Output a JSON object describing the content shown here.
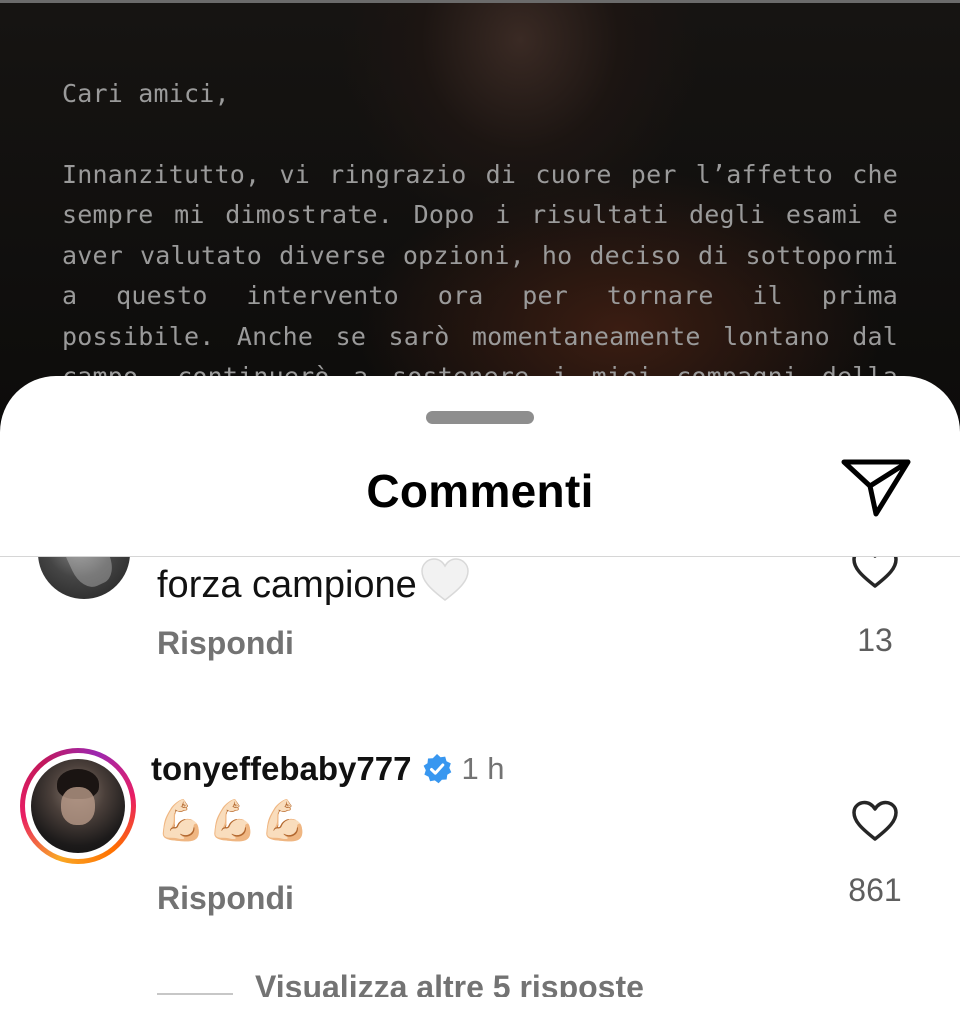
{
  "post": {
    "greeting": "Cari amici,",
    "body": "Innanzitutto, vi ringrazio di cuore per l’affetto che sempre mi dimostrate. Dopo i risultati degli esami e aver valutato diverse opzioni, ho deciso di sottopormi a questo intervento ora per tornare il prima possibile. Anche se sarò momentaneamente lontano dal campo, continuerò a sostenere i miei compagni della Roma in"
  },
  "sheet": {
    "title": "Commenti",
    "share_icon": "send-paper-plane-icon"
  },
  "comments": [
    {
      "text": "forza campione",
      "emoji": "white-heart-emoji",
      "reply_label": "Rispondi",
      "like_count": "13",
      "like_icon": "heart-outline-icon"
    },
    {
      "username": "tonyeffebaby777",
      "verified": true,
      "time": "1 h",
      "text": "💪🏻💪🏻💪🏻",
      "reply_label": "Rispondi",
      "like_count": "861",
      "like_icon": "heart-outline-icon"
    }
  ],
  "view_more_replies": "Visualizza altre 5 risposte",
  "colors": {
    "verified_blue": "#3897f0",
    "secondary_text": "#737373",
    "sheet_bg": "#ffffff"
  }
}
